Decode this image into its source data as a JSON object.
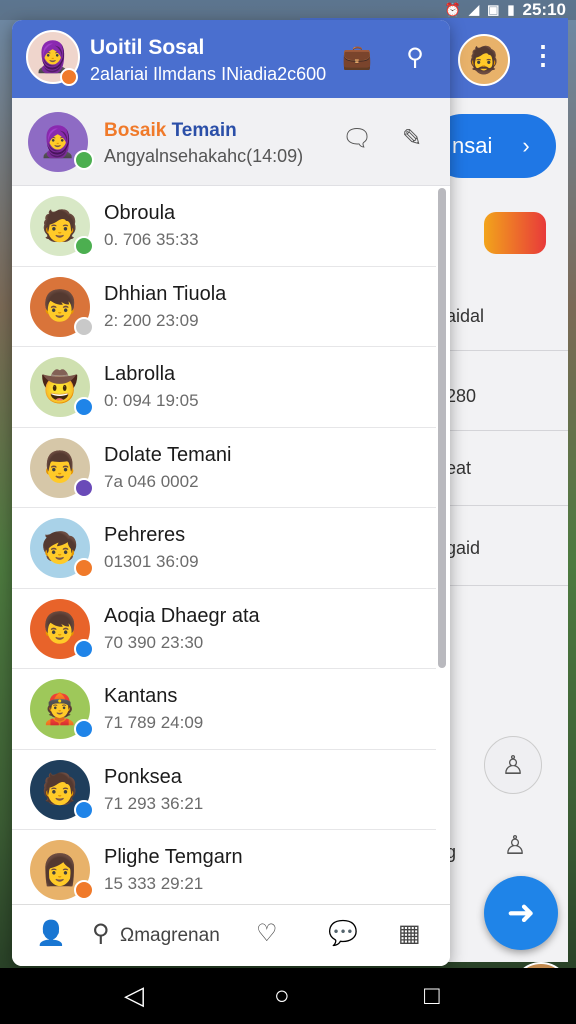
{
  "status_bar": {
    "time": "25:10",
    "icons": [
      "alarm-icon",
      "signal-icon",
      "data-icon",
      "battery-icon"
    ]
  },
  "drawer": {
    "header": {
      "title": "Uoitil Sosal",
      "subtitle": "2alariai Ilmdans INiadia2c600",
      "icons": [
        "briefcase-icon",
        "search-icon"
      ]
    },
    "self": {
      "name_part1": "Bosaik",
      "name_part2": " Temain",
      "status": "Angyalnsehakahc(14:09)"
    },
    "contacts": [
      {
        "name": "Obroula",
        "time": "0. 706 35:33",
        "badge_color": "#4caf50",
        "avatar_bg": "#d8e8c6",
        "avatar": "🧑"
      },
      {
        "name": "Dhhian Tiuola",
        "time": "2: 200 23:09",
        "badge_color": "#c9c9c9",
        "avatar_bg": "#d9743a",
        "avatar": "👦"
      },
      {
        "name": "Labrolla",
        "time": "0: 094 19:05",
        "badge_color": "#1f84e8",
        "avatar_bg": "#cfe0b0",
        "avatar": "🤠"
      },
      {
        "name": "Dolate Temani",
        "time": "7a 046 0002",
        "badge_color": "#6a4ab8",
        "avatar_bg": "#d6c7a8",
        "avatar": "👨"
      },
      {
        "name": "Pehreres",
        "time": "01301 36:09",
        "badge_color": "#f07a2a",
        "avatar_bg": "#a9d2e8",
        "avatar": "🧒"
      },
      {
        "name": "Aoqia Dhaegr ata",
        "time": "70 390 23:30",
        "badge_color": "#1f84e8",
        "avatar_bg": "#e8632a",
        "avatar": "👦"
      },
      {
        "name": "Kantans",
        "time": "71 789 24:09",
        "badge_color": "#1f84e8",
        "avatar_bg": "#9ec85a",
        "avatar": "👲"
      },
      {
        "name": "Ponksea",
        "time": "71 293 36:21",
        "badge_color": "#1f84e8",
        "avatar_bg": "#1f3e5c",
        "avatar": "🧑"
      },
      {
        "name": "Plighe Temgarn",
        "time": "15 333 29:21",
        "badge_color": "#f07a2a",
        "avatar_bg": "#e8b26a",
        "avatar": "👩"
      }
    ],
    "bottom_nav": {
      "search_label": "Ωmagrenan"
    }
  },
  "background_app": {
    "pill_label": "nsai",
    "texts": [
      "aidal",
      "280",
      "eat",
      "gaid",
      "g"
    ]
  }
}
